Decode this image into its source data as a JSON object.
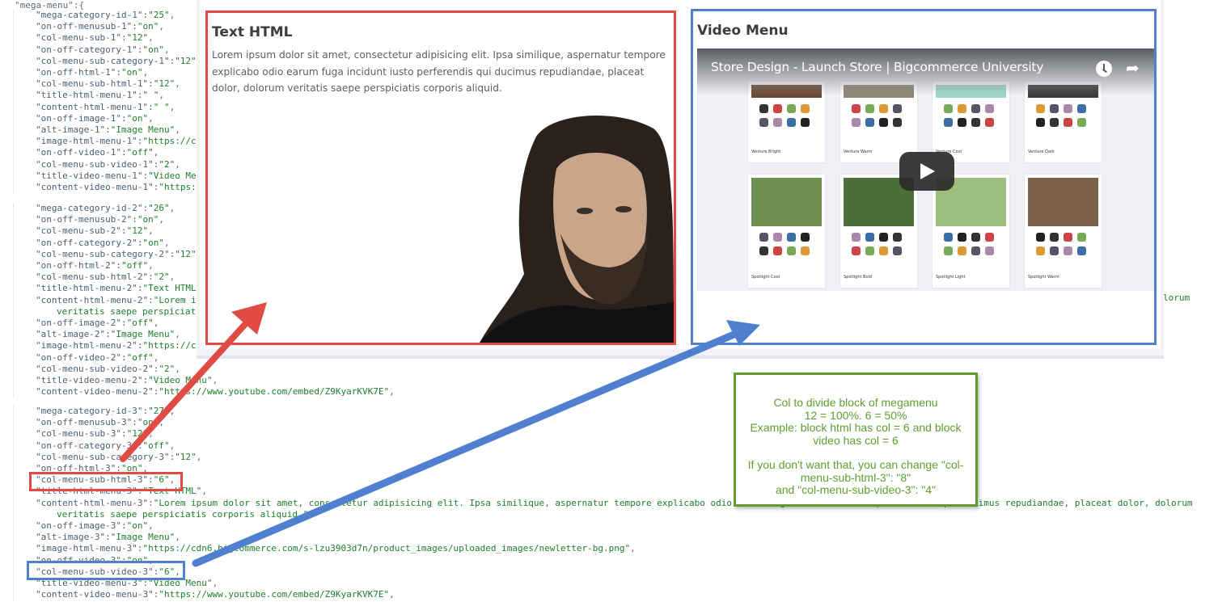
{
  "code": {
    "root_line": "\"mega-menu\":{",
    "group1": [
      [
        "mega-category-id-1",
        "25",
        ","
      ],
      [
        "on-off-menusub-1",
        "on",
        ","
      ],
      [
        "col-menu-sub-1",
        "12",
        ","
      ],
      [
        "on-off-category-1",
        "on",
        ","
      ],
      [
        "col-menu-sub-category-1",
        "12",
        ""
      ],
      [
        "on-off-html-1",
        "on",
        ","
      ],
      [
        "col-menu-sub-html-1",
        "12",
        ","
      ],
      [
        "title-html-menu-1",
        " ",
        ","
      ],
      [
        "content-html-menu-1",
        " ",
        ","
      ],
      [
        "on-off-image-1",
        "on",
        ","
      ],
      [
        "alt-image-1",
        "Image Menu",
        ","
      ],
      [
        "image-html-menu-1",
        "https://c",
        ""
      ],
      [
        "on-off-video-1",
        "off",
        ","
      ],
      [
        "col-menu-sub-video-1",
        "2",
        ","
      ],
      [
        "title-video-menu-1",
        "Video Me",
        ""
      ],
      [
        "content-video-menu-1",
        "https:",
        ""
      ]
    ],
    "group2": [
      [
        "mega-category-id-2",
        "26",
        ","
      ],
      [
        "on-off-menusub-2",
        "on",
        ","
      ],
      [
        "col-menu-sub-2",
        "12",
        ","
      ],
      [
        "on-off-category-2",
        "on",
        ","
      ],
      [
        "col-menu-sub-category-2",
        "12",
        ""
      ],
      [
        "on-off-html-2",
        "off",
        ","
      ],
      [
        "col-menu-sub-html-2",
        "2",
        ","
      ],
      [
        "title-html-menu-2",
        "Text HTML",
        ""
      ],
      [
        "content-html-menu-2",
        "Lorem i",
        ""
      ],
      [
        "",
        "veritatis saepe perspiciat",
        ""
      ],
      [
        "on-off-image-2",
        "off",
        ","
      ],
      [
        "alt-image-2",
        "Image Menu",
        ","
      ],
      [
        "image-html-menu-2",
        "https://c",
        ""
      ],
      [
        "on-off-video-2",
        "off",
        ","
      ],
      [
        "col-menu-sub-video-2",
        "2",
        ","
      ],
      [
        "title-video-menu-2",
        "Video Menu",
        ","
      ],
      [
        "content-video-menu-2",
        "https://www.youtube.com/embed/Z9KyarKVK7E",
        ","
      ]
    ],
    "group3": [
      [
        "mega-category-id-3",
        "27",
        ","
      ],
      [
        "on-off-menusub-3",
        "on",
        ","
      ],
      [
        "col-menu-sub-3",
        "12",
        ","
      ],
      [
        "on-off-category-3",
        "off",
        ","
      ],
      [
        "col-menu-sub-category-3",
        "12",
        ","
      ],
      [
        "on-off-html-3",
        "on",
        ","
      ],
      [
        "col-menu-sub-html-3",
        "6",
        ","
      ],
      [
        "title-html-menu-3",
        "Text HTML",
        ","
      ],
      [
        "content-html-menu-3",
        "Lorem ipsum dolor sit amet, consectetur adipisicing elit. Ipsa similique, aspernatur tempore explicabo odio earum fuga incidunt iusto perferendis qui ducimus repudiandae, placeat dolor, dolorum",
        ""
      ],
      [
        "",
        "veritatis saepe perspiciatis corporis aliquid.",
        ","
      ],
      [
        "on-off-image-3",
        "on",
        ","
      ],
      [
        "alt-image-3",
        "Image Menu",
        ","
      ],
      [
        "image-html-menu-3",
        "https://cdn6.bigcommerce.com/s-lzu3903d7n/product_images/uploaded_images/newletter-bg.png",
        ","
      ],
      [
        "on-off-video-3",
        "on",
        ","
      ],
      [
        "col-menu-sub-video-3",
        "6",
        ","
      ],
      [
        "title-video-menu-3",
        "Video Menu",
        ","
      ],
      [
        "content-video-menu-3",
        "https://www.youtube.com/embed/Z9KyarKVK7E",
        ","
      ]
    ],
    "overflow_right": "lorum"
  },
  "html_block": {
    "title": "Text HTML",
    "body": "Lorem ipsum dolor sit amet, consectetur adipisicing elit. Ipsa similique, aspernatur tempore explicabo odio earum fuga incidunt iusto perferendis qui ducimus repudiandae, placeat dolor, dolorum veritatis saepe perspiciatis corporis aliquid.",
    "image_alt": "Image Menu"
  },
  "video_block": {
    "title": "Video Menu",
    "video_title": "Store Design - Launch Store | Bigcommerce University",
    "watch_later_icon": "clock-icon",
    "share_icon": "share-arrow-icon",
    "play_icon": "youtube-play-icon",
    "cards": [
      {
        "name": "Venture Bright",
        "shot": "#6b4a34"
      },
      {
        "name": "Venture Warm",
        "shot": "#8c8672"
      },
      {
        "name": "Venture Cool",
        "shot": "#9fd6c8"
      },
      {
        "name": "Venture Dark",
        "shot": "#3c3c3c"
      },
      {
        "name": "Spotlight Cool",
        "shot": "#6f8f52"
      },
      {
        "name": "Spotlight Bold",
        "shot": "#4d6e36"
      },
      {
        "name": "Spotlight Light",
        "shot": "#9cbf7e"
      },
      {
        "name": "Spotlight Warm",
        "shot": "#7b6249"
      }
    ]
  },
  "note": {
    "lines": [
      "Col to divide block of megamenu",
      "12 = 100%. 6 = 50%",
      "Example: block html has col = 6 and block video has col = 6",
      "",
      "If you don't want that, you can change \"col-menu-sub-html-3\": \"8\"",
      "and \"col-menu-sub-video-3\": \"4\""
    ]
  },
  "colors": {
    "html_highlight": "#e14b45",
    "video_highlight": "#4f7fcf",
    "note_accent": "#5e9e2e"
  }
}
